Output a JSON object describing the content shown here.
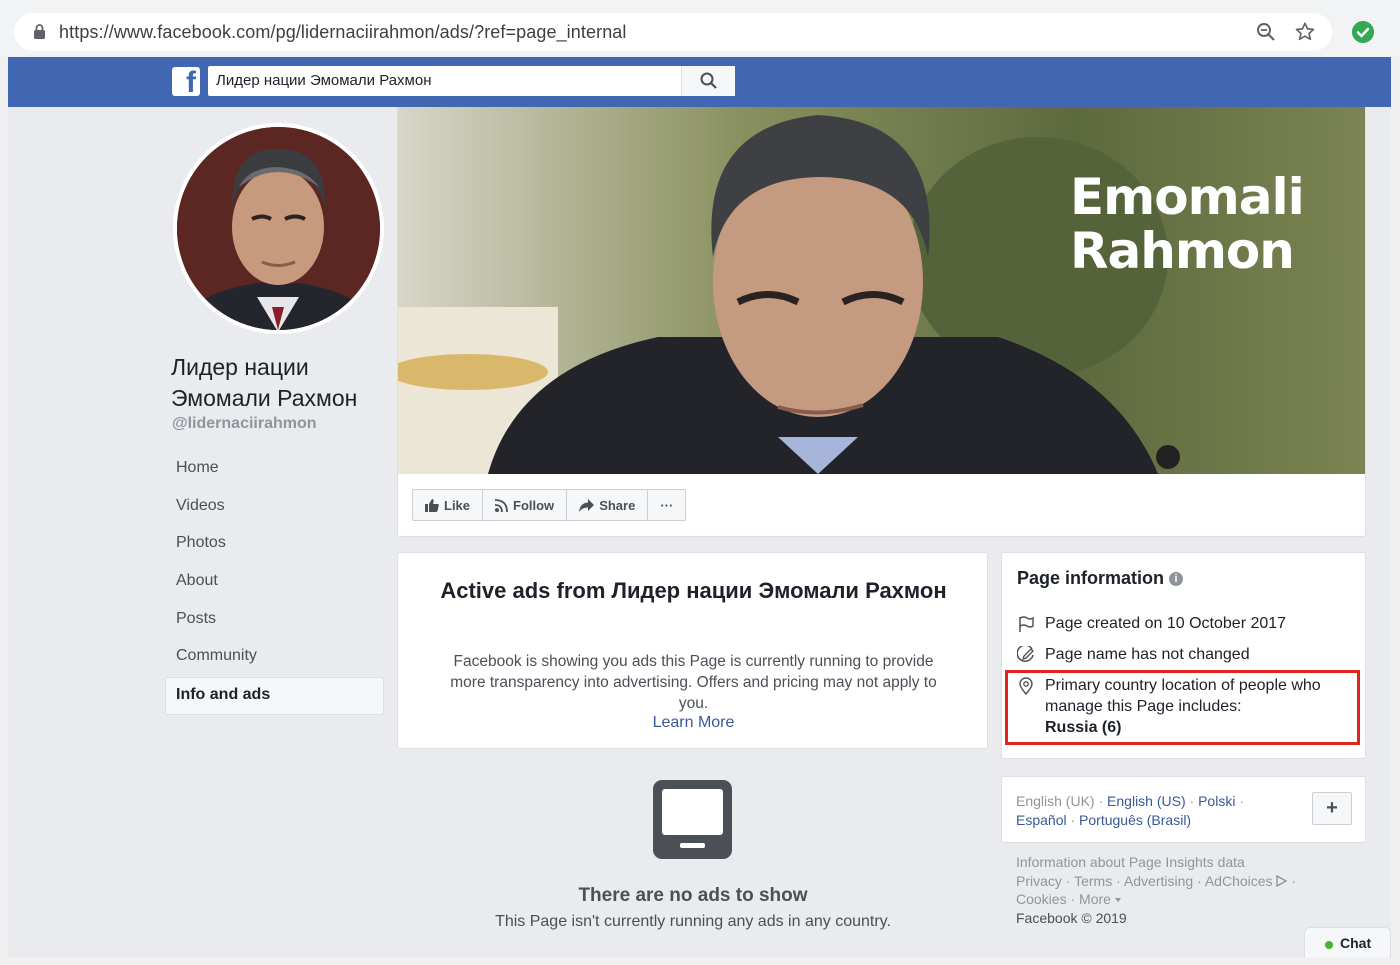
{
  "browser": {
    "url": "https://www.facebook.com/pg/lidernaciirahmon/ads/?ref=page_internal"
  },
  "facebook": {
    "search_value": "Лидер нации Эмомали Рахмон",
    "logo_letter": "f"
  },
  "page": {
    "name": "Лидер нации Эмомали Рахмон",
    "handle": "@lidernaciirahmon",
    "cover_text_line1": "Emomali",
    "cover_text_line2": "Rahmon"
  },
  "nav": {
    "items": [
      "Home",
      "Videos",
      "Photos",
      "About",
      "Posts",
      "Community",
      "Info and ads"
    ],
    "active": "Info and ads"
  },
  "actions": {
    "like": "Like",
    "follow": "Follow",
    "share": "Share",
    "more": "···"
  },
  "ads": {
    "title": "Active ads from Лидер нации Эмомали Рахмон",
    "description": "Facebook is showing you ads this Page is currently running to provide more transparency into advertising. Offers and pricing may not apply to you.",
    "learn_more": "Learn More",
    "empty_title": "There are no ads to show",
    "empty_subtitle": "This Page isn't currently running any ads in any country."
  },
  "page_info": {
    "title": "Page information",
    "info_glyph": "i",
    "created": "Page created on 10 October 2017",
    "name_status": "Page name has not changed",
    "location_line1": "Primary country location of people who",
    "location_line2": "manage this Page includes:",
    "location_value": "Russia (6)"
  },
  "languages": {
    "current": "English (UK)",
    "links": [
      "English (US)",
      "Polski",
      "Español",
      "Português (Brasil)"
    ],
    "add": "+"
  },
  "footer": {
    "insights": "Information about Page Insights data",
    "privacy": "Privacy",
    "terms": "Terms",
    "advertising": "Advertising",
    "adchoices": "AdChoices",
    "cookies": "Cookies",
    "more": "More",
    "copyright": "Facebook © 2019"
  },
  "chat": {
    "label": "Chat"
  },
  "colors": {
    "facebook_blue": "#4267b2",
    "link": "#385898",
    "highlight_red": "#e0261c",
    "online_green": "#42b72a"
  }
}
